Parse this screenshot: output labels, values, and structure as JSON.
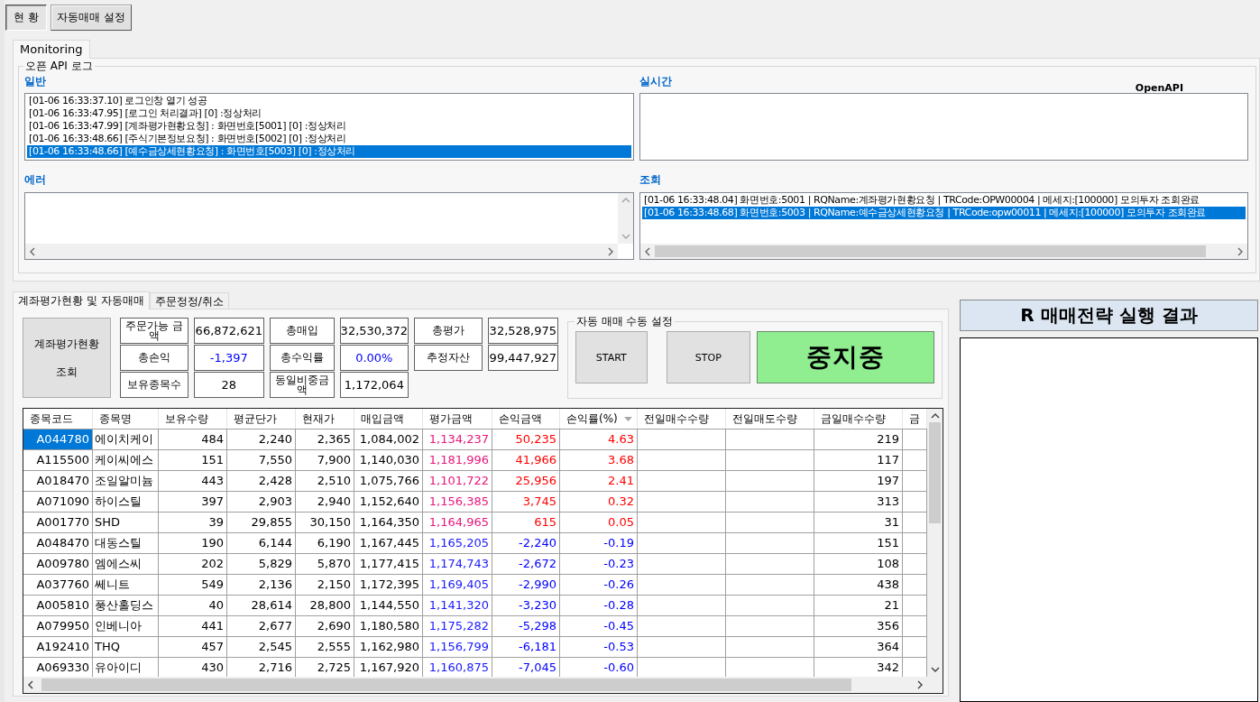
{
  "top_buttons": [
    {
      "label": "현 황",
      "selected": true
    },
    {
      "label": "자동매매 설정",
      "selected": false
    }
  ],
  "monitor_tabs": [
    {
      "label": "Monitoring",
      "selected": true
    }
  ],
  "log_group": {
    "title": "오픈 API 로그",
    "corner_text": "OpenAPI",
    "panels": [
      {
        "title": "일반",
        "vertical_scroll": false,
        "horizontal_scroll": false,
        "items": [
          {
            "text": "[01-06 16:33:37.10] 로그인창 열기 성공",
            "selected": false
          },
          {
            "text": "[01-06 16:33:47.95] [로그인 처리결과] [0] :정상처리",
            "selected": false
          },
          {
            "text": "[01-06 16:33:47.99] [계좌평가현황요청] : 화면번호[5001] [0] :정상처리",
            "selected": false
          },
          {
            "text": "[01-06 16:33:48.66] [주식기본정보요청] : 화면번호[5002] [0] :정상처리",
            "selected": false
          },
          {
            "text": "[01-06 16:33:48.66] [예수금상세현황요청] : 화면번호[5003] [0] :정상처리",
            "selected": true
          }
        ]
      },
      {
        "title": "실시간",
        "vertical_scroll": false,
        "horizontal_scroll": false
      },
      {
        "title": "에러",
        "vertical_scroll": true,
        "horizontal_scroll": true
      },
      {
        "title": "조회",
        "vertical_scroll": false,
        "horizontal_scroll": true,
        "items": [
          {
            "text": "[01-06 16:33:48.04] 화면번호:5001 | RQName:계좌평가현황요청 | TRCode:OPW00004 | 메세지:[100000] 모의투자 조회완료",
            "selected": false
          },
          {
            "text": "[01-06 16:33:48.68] 화면번호:5003 | RQName:예수금상세현황요청 | TRCode:opw00011 | 메세지:[100000] 모의투자 조회완료",
            "selected": true
          }
        ]
      }
    ]
  },
  "account_tabs": [
    {
      "label": "계좌평가현황 및 자동매매",
      "selected": true
    },
    {
      "label": "주문정정/취소",
      "selected": false
    }
  ],
  "query_button": [
    "계좌평가현황",
    "조회"
  ],
  "summary": [
    [
      {
        "label": "주문가능 금액",
        "value": "66,872,621"
      },
      {
        "label": "총매입",
        "value": "32,530,372"
      },
      {
        "label": "총평가",
        "value": "32,528,975"
      }
    ],
    [
      {
        "label": "총손익",
        "value": "-1,397",
        "color": "#0000ff"
      },
      {
        "label": "총수익률",
        "value": "0.00%",
        "color": "#0000ff"
      },
      {
        "label": "추정자산",
        "value": "99,447,927"
      }
    ],
    [
      {
        "label": "보유종목수",
        "value": "28"
      },
      {
        "label": "동일비중금액",
        "value": "1,172,064"
      }
    ]
  ],
  "auto_group": {
    "title": "자동 매매 수동 설정",
    "buttons": [
      "START",
      "STOP"
    ],
    "status": {
      "label": "중지중",
      "running": false
    }
  },
  "table": {
    "columns": [
      {
        "label": "종목코드",
        "sorted": false
      },
      {
        "label": "종목명",
        "sorted": false
      },
      {
        "label": "보유수량",
        "sorted": false
      },
      {
        "label": "평균단가",
        "sorted": false
      },
      {
        "label": "현재가",
        "sorted": false
      },
      {
        "label": "매입금액",
        "sorted": false
      },
      {
        "label": "평가금액",
        "sorted": false
      },
      {
        "label": "손익금액",
        "sorted": false
      },
      {
        "label": "손익률(%)",
        "sorted": true
      },
      {
        "label": "전일매수수량",
        "sorted": false
      },
      {
        "label": "전일매도수량",
        "sorted": false
      },
      {
        "label": "금일매수수량",
        "sorted": false
      },
      {
        "label": "금",
        "sorted": false
      }
    ],
    "rows": [
      {
        "code": "A044780",
        "name": "에이치케이",
        "qty": "484",
        "avg": "2,240",
        "price": "2,365",
        "buy": "1,084,002",
        "eval": "1,134,237",
        "pl": "50,235",
        "rate": "4.63",
        "today_buy": "219",
        "profit": true,
        "selected": true
      },
      {
        "code": "A115500",
        "name": "케이씨에스",
        "qty": "151",
        "avg": "7,550",
        "price": "7,900",
        "buy": "1,140,030",
        "eval": "1,181,996",
        "pl": "41,966",
        "rate": "3.68",
        "today_buy": "117",
        "profit": true,
        "selected": false
      },
      {
        "code": "A018470",
        "name": "조일알미늄",
        "qty": "443",
        "avg": "2,428",
        "price": "2,510",
        "buy": "1,075,766",
        "eval": "1,101,722",
        "pl": "25,956",
        "rate": "2.41",
        "today_buy": "197",
        "profit": true,
        "selected": false
      },
      {
        "code": "A071090",
        "name": "하이스틸",
        "qty": "397",
        "avg": "2,903",
        "price": "2,940",
        "buy": "1,152,640",
        "eval": "1,156,385",
        "pl": "3,745",
        "rate": "0.32",
        "today_buy": "313",
        "profit": true,
        "selected": false
      },
      {
        "code": "A001770",
        "name": "SHD",
        "qty": "39",
        "avg": "29,855",
        "price": "30,150",
        "buy": "1,164,350",
        "eval": "1,164,965",
        "pl": "615",
        "rate": "0.05",
        "today_buy": "31",
        "profit": true,
        "selected": false
      },
      {
        "code": "A048470",
        "name": "대동스틸",
        "qty": "190",
        "avg": "6,144",
        "price": "6,190",
        "buy": "1,167,445",
        "eval": "1,165,205",
        "pl": "-2,240",
        "rate": "-0.19",
        "today_buy": "151",
        "profit": false,
        "selected": false
      },
      {
        "code": "A009780",
        "name": "엠에스씨",
        "qty": "202",
        "avg": "5,829",
        "price": "5,870",
        "buy": "1,177,415",
        "eval": "1,174,743",
        "pl": "-2,672",
        "rate": "-0.23",
        "today_buy": "108",
        "profit": false,
        "selected": false
      },
      {
        "code": "A037760",
        "name": "쎄니트",
        "qty": "549",
        "avg": "2,136",
        "price": "2,150",
        "buy": "1,172,395",
        "eval": "1,169,405",
        "pl": "-2,990",
        "rate": "-0.26",
        "today_buy": "438",
        "profit": false,
        "selected": false
      },
      {
        "code": "A005810",
        "name": "풍산홀딩스",
        "qty": "40",
        "avg": "28,614",
        "price": "28,800",
        "buy": "1,144,550",
        "eval": "1,141,320",
        "pl": "-3,230",
        "rate": "-0.28",
        "today_buy": "21",
        "profit": false,
        "selected": false
      },
      {
        "code": "A079950",
        "name": "인베니아",
        "qty": "441",
        "avg": "2,677",
        "price": "2,690",
        "buy": "1,180,580",
        "eval": "1,175,282",
        "pl": "-5,298",
        "rate": "-0.45",
        "today_buy": "356",
        "profit": false,
        "selected": false
      },
      {
        "code": "A192410",
        "name": "THQ",
        "qty": "457",
        "avg": "2,545",
        "price": "2,555",
        "buy": "1,162,980",
        "eval": "1,156,799",
        "pl": "-6,181",
        "rate": "-0.53",
        "today_buy": "364",
        "profit": false,
        "selected": false
      },
      {
        "code": "A069330",
        "name": "유아이디",
        "qty": "430",
        "avg": "2,716",
        "price": "2,725",
        "buy": "1,167,920",
        "eval": "1,160,875",
        "pl": "-7,045",
        "rate": "-0.60",
        "today_buy": "342",
        "profit": false,
        "selected": false
      }
    ]
  },
  "result_panel": {
    "title": "R 매매전략 실행 결과"
  }
}
